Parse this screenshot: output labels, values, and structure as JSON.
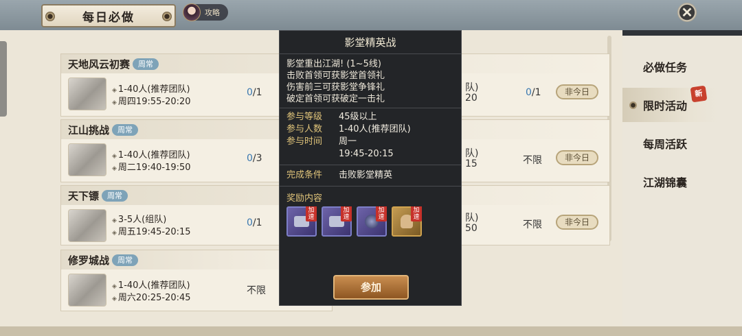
{
  "header": {
    "title": "每日必做",
    "guide_label": "攻略",
    "close_glyph": "✕"
  },
  "cards": [
    {
      "title": "天地风云初赛",
      "tag": "周常",
      "players": "1-40人(推荐团队)",
      "time": "周四19:55-20:20",
      "count_done": "0",
      "count_total": "/1",
      "right_count_done": "0",
      "right_count_total": "/1",
      "status": "非今日",
      "hidden_fragment_a": "队)",
      "hidden_fragment_b": "20"
    },
    {
      "title": "江山挑战",
      "tag": "周常",
      "players": "1-40人(推荐团队)",
      "time": "周二19:40-19:50",
      "count_done": "0",
      "count_total": "/3",
      "right_limit": "不限",
      "status": "非今日",
      "hidden_fragment_a": "队)",
      "hidden_fragment_b": "15"
    },
    {
      "title": "天下镖",
      "tag": "周常",
      "players": "3-5人(组队)",
      "time": "周五19:45-20:15",
      "count_done": "0",
      "count_total": "/1",
      "right_limit": "不限",
      "status": "非今日",
      "hidden_fragment_a": "队)",
      "hidden_fragment_b": "50"
    },
    {
      "title": "修罗城战",
      "tag": "周常",
      "players": "1-40人(推荐团队)",
      "time": "周六20:25-20:45",
      "limit": "不限"
    }
  ],
  "sidebar": {
    "tabs": [
      {
        "label": "必做任务"
      },
      {
        "label": "限时活动",
        "badge": "新"
      },
      {
        "label": "每周活跃"
      },
      {
        "label": "江湖锦囊"
      }
    ]
  },
  "popup": {
    "title": "影堂精英战",
    "desc": [
      "影堂重出江湖! (1~5线)",
      "击败首领可获影堂首领礼",
      "伤害前三可获影堂争锋礼",
      "破定首领可获破定一击礼"
    ],
    "level_label": "参与等级",
    "level_value": "45级以上",
    "people_label": "参与人数",
    "people_value": "1-40人(推荐团队)",
    "time_label": "参与时间",
    "time_day": "周一",
    "time_range": "19:45-20:15",
    "cond_label": "完成条件",
    "cond_value": "击败影堂精英",
    "reward_label": "奖励内容",
    "rewards": [
      {
        "icon": "chest-icon",
        "tag": "加速"
      },
      {
        "icon": "chest-icon",
        "tag": "加速"
      },
      {
        "icon": "orb-icon",
        "tag": "加速"
      },
      {
        "icon": "pouch-icon",
        "tag": "加速"
      }
    ],
    "join_label": "参加"
  }
}
